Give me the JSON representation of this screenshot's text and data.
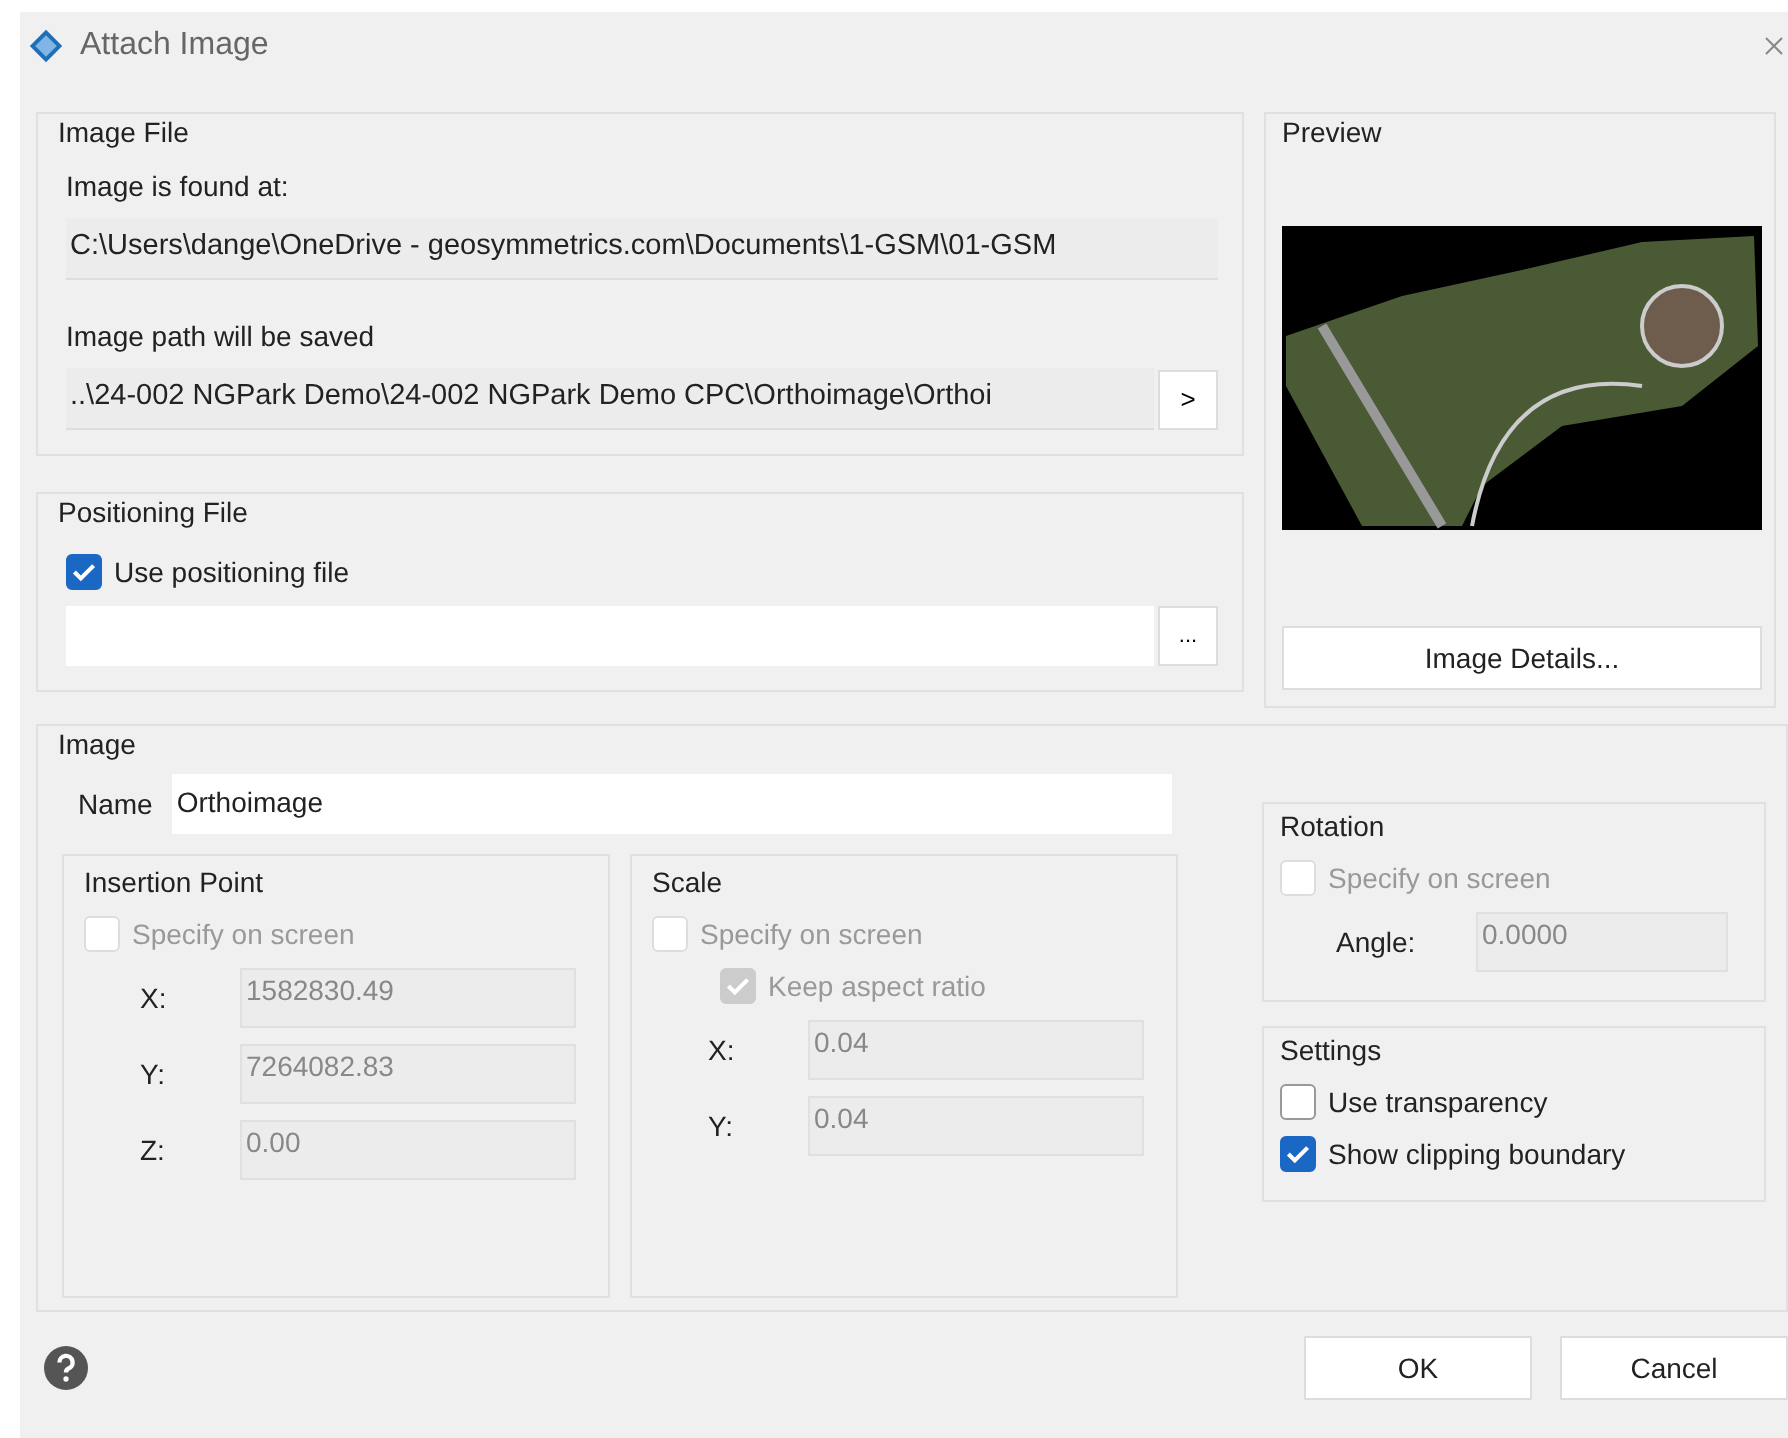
{
  "window": {
    "title": "Attach Image"
  },
  "image_file": {
    "title": "Image File",
    "found_label": "Image is found at:",
    "found_path": "C:\\Users\\dange\\OneDrive - geosymmetrics.com\\Documents\\1-GSM\\01-GSM",
    "saved_label": "Image path will be saved",
    "saved_path": "..\\24-002 NGPark Demo\\24-002 NGPark Demo CPC\\Orthoimage\\Orthoi",
    "browse_button": ">"
  },
  "positioning_file": {
    "title": "Positioning File",
    "checkbox": {
      "label": "Use positioning file",
      "checked": true
    },
    "browse_button": "..."
  },
  "preview": {
    "title": "Preview",
    "details_button": "Image Details..."
  },
  "image": {
    "title": "Image",
    "name_label": "Name",
    "name_value": "Orthoimage",
    "insertion_point": {
      "title": "Insertion Point",
      "specify": {
        "label": "Specify on screen",
        "checked": false,
        "disabled": true
      },
      "fields": [
        {
          "label": "X:",
          "value": "1582830.49",
          "disabled": true
        },
        {
          "label": "Y:",
          "value": "7264082.83",
          "disabled": true
        },
        {
          "label": "Z:",
          "value": "0.00",
          "disabled": true
        }
      ]
    },
    "scale": {
      "title": "Scale",
      "specify": {
        "label": "Specify on screen",
        "checked": false,
        "disabled": true
      },
      "keep_aspect": {
        "label": "Keep aspect ratio",
        "checked": true,
        "disabled": true
      },
      "fields": [
        {
          "label": "X:",
          "value": "0.04",
          "disabled": true
        },
        {
          "label": "Y:",
          "value": "0.04",
          "disabled": true
        }
      ]
    },
    "rotation": {
      "title": "Rotation",
      "specify": {
        "label": "Specify on screen",
        "checked": false,
        "disabled": true
      },
      "angle": {
        "label": "Angle:",
        "value": "0.0000",
        "disabled": true
      }
    },
    "settings": {
      "title": "Settings",
      "options": [
        {
          "label": "Use transparency",
          "checked": false,
          "disabled": false
        },
        {
          "label": "Show clipping boundary",
          "checked": true,
          "disabled": false
        }
      ]
    }
  },
  "buttons": [
    {
      "label": "OK"
    },
    {
      "label": "Cancel"
    }
  ]
}
